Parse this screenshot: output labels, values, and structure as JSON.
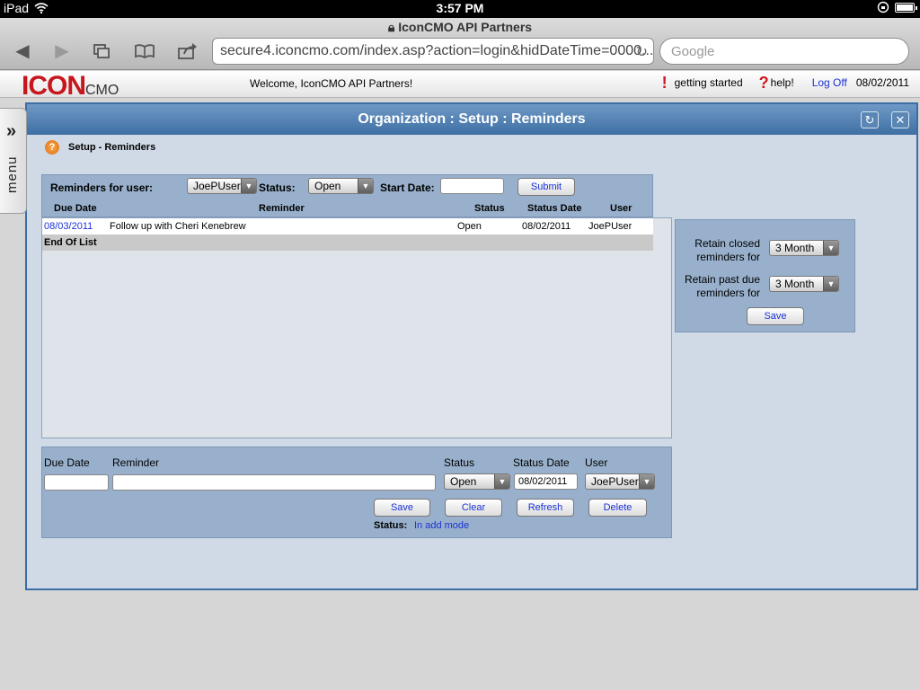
{
  "statusbar": {
    "device": "iPad",
    "time": "3:57 PM"
  },
  "browser": {
    "title": "IconCMO  API Partners",
    "url": "secure4.iconcmo.com/index.asp?action=login&hidDateTime=0000...",
    "search_placeholder": "Google"
  },
  "header": {
    "logo_main": "ICON",
    "logo_sub": "CMO",
    "welcome": "Welcome, IconCMO API Partners!",
    "getting_started": "getting started",
    "help": "help!",
    "logoff": "Log Off",
    "date": "08/02/2011"
  },
  "sidemenu": {
    "label": "menu"
  },
  "window": {
    "title": "Organization : Setup : Reminders",
    "breadcrumb": "Setup - Reminders"
  },
  "filter": {
    "user_label": "Reminders for user:",
    "user_value": "JoePUser",
    "status_label": "Status:",
    "status_value": "Open",
    "start_label": "Start Date:",
    "start_value": "",
    "submit": "Submit"
  },
  "table": {
    "columns": [
      "Due Date",
      "Reminder",
      "Status",
      "Status Date",
      "User"
    ],
    "rows": [
      {
        "due": "08/03/2011",
        "reminder": "Follow up with Cheri Kenebrew",
        "status": "Open",
        "status_date": "08/02/2011",
        "user": "JoePUser"
      }
    ],
    "end_text": "End Of List"
  },
  "retain": {
    "closed_line1": "Retain closed",
    "closed_line2": "reminders for",
    "closed_value": "3 Month",
    "pastdue_line1": "Retain past due",
    "pastdue_line2": "reminders for",
    "pastdue_value": "3 Month",
    "save": "Save"
  },
  "edit": {
    "due_label": "Due Date",
    "reminder_label": "Reminder",
    "status_label": "Status",
    "status_date_label": "Status Date",
    "user_label": "User",
    "due_value": "",
    "reminder_value": "",
    "status_value": "Open",
    "status_date_value": "08/02/2011",
    "user_value": "JoePUser",
    "save": "Save",
    "clear": "Clear",
    "refresh": "Refresh",
    "delete": "Delete",
    "mode_label": "Status:",
    "mode_value": "In add mode"
  }
}
